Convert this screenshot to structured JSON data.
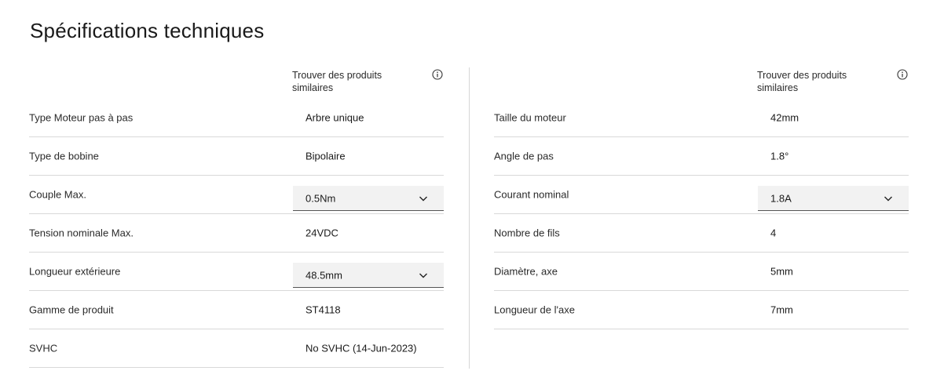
{
  "title": "Spécifications techniques",
  "find_similar_label": "Trouver des produits similaires",
  "left_rows": [
    {
      "label": "Type Moteur pas à pas",
      "value": "Arbre unique",
      "kind": "text"
    },
    {
      "label": "Type de bobine",
      "value": "Bipolaire",
      "kind": "text"
    },
    {
      "label": "Couple Max.",
      "value": "0.5Nm",
      "kind": "select"
    },
    {
      "label": "Tension nominale Max.",
      "value": "24VDC",
      "kind": "text"
    },
    {
      "label": "Longueur extérieure",
      "value": "48.5mm",
      "kind": "select"
    },
    {
      "label": "Gamme de produit",
      "value": "ST4118",
      "kind": "text"
    },
    {
      "label": "SVHC",
      "value": "No SVHC (14-Jun-2023)",
      "kind": "text"
    }
  ],
  "right_rows": [
    {
      "label": "Taille du moteur",
      "value": "42mm",
      "kind": "text"
    },
    {
      "label": "Angle de pas",
      "value": "1.8°",
      "kind": "text"
    },
    {
      "label": "Courant nominal",
      "value": "1.8A",
      "kind": "select"
    },
    {
      "label": "Nombre de fils",
      "value": "4",
      "kind": "text"
    },
    {
      "label": "Diamètre, axe",
      "value": "5mm",
      "kind": "text"
    },
    {
      "label": "Longueur de l'axe",
      "value": "7mm",
      "kind": "text"
    }
  ],
  "icons": {
    "info": "info-icon",
    "chevron": "chevron-down-icon"
  }
}
